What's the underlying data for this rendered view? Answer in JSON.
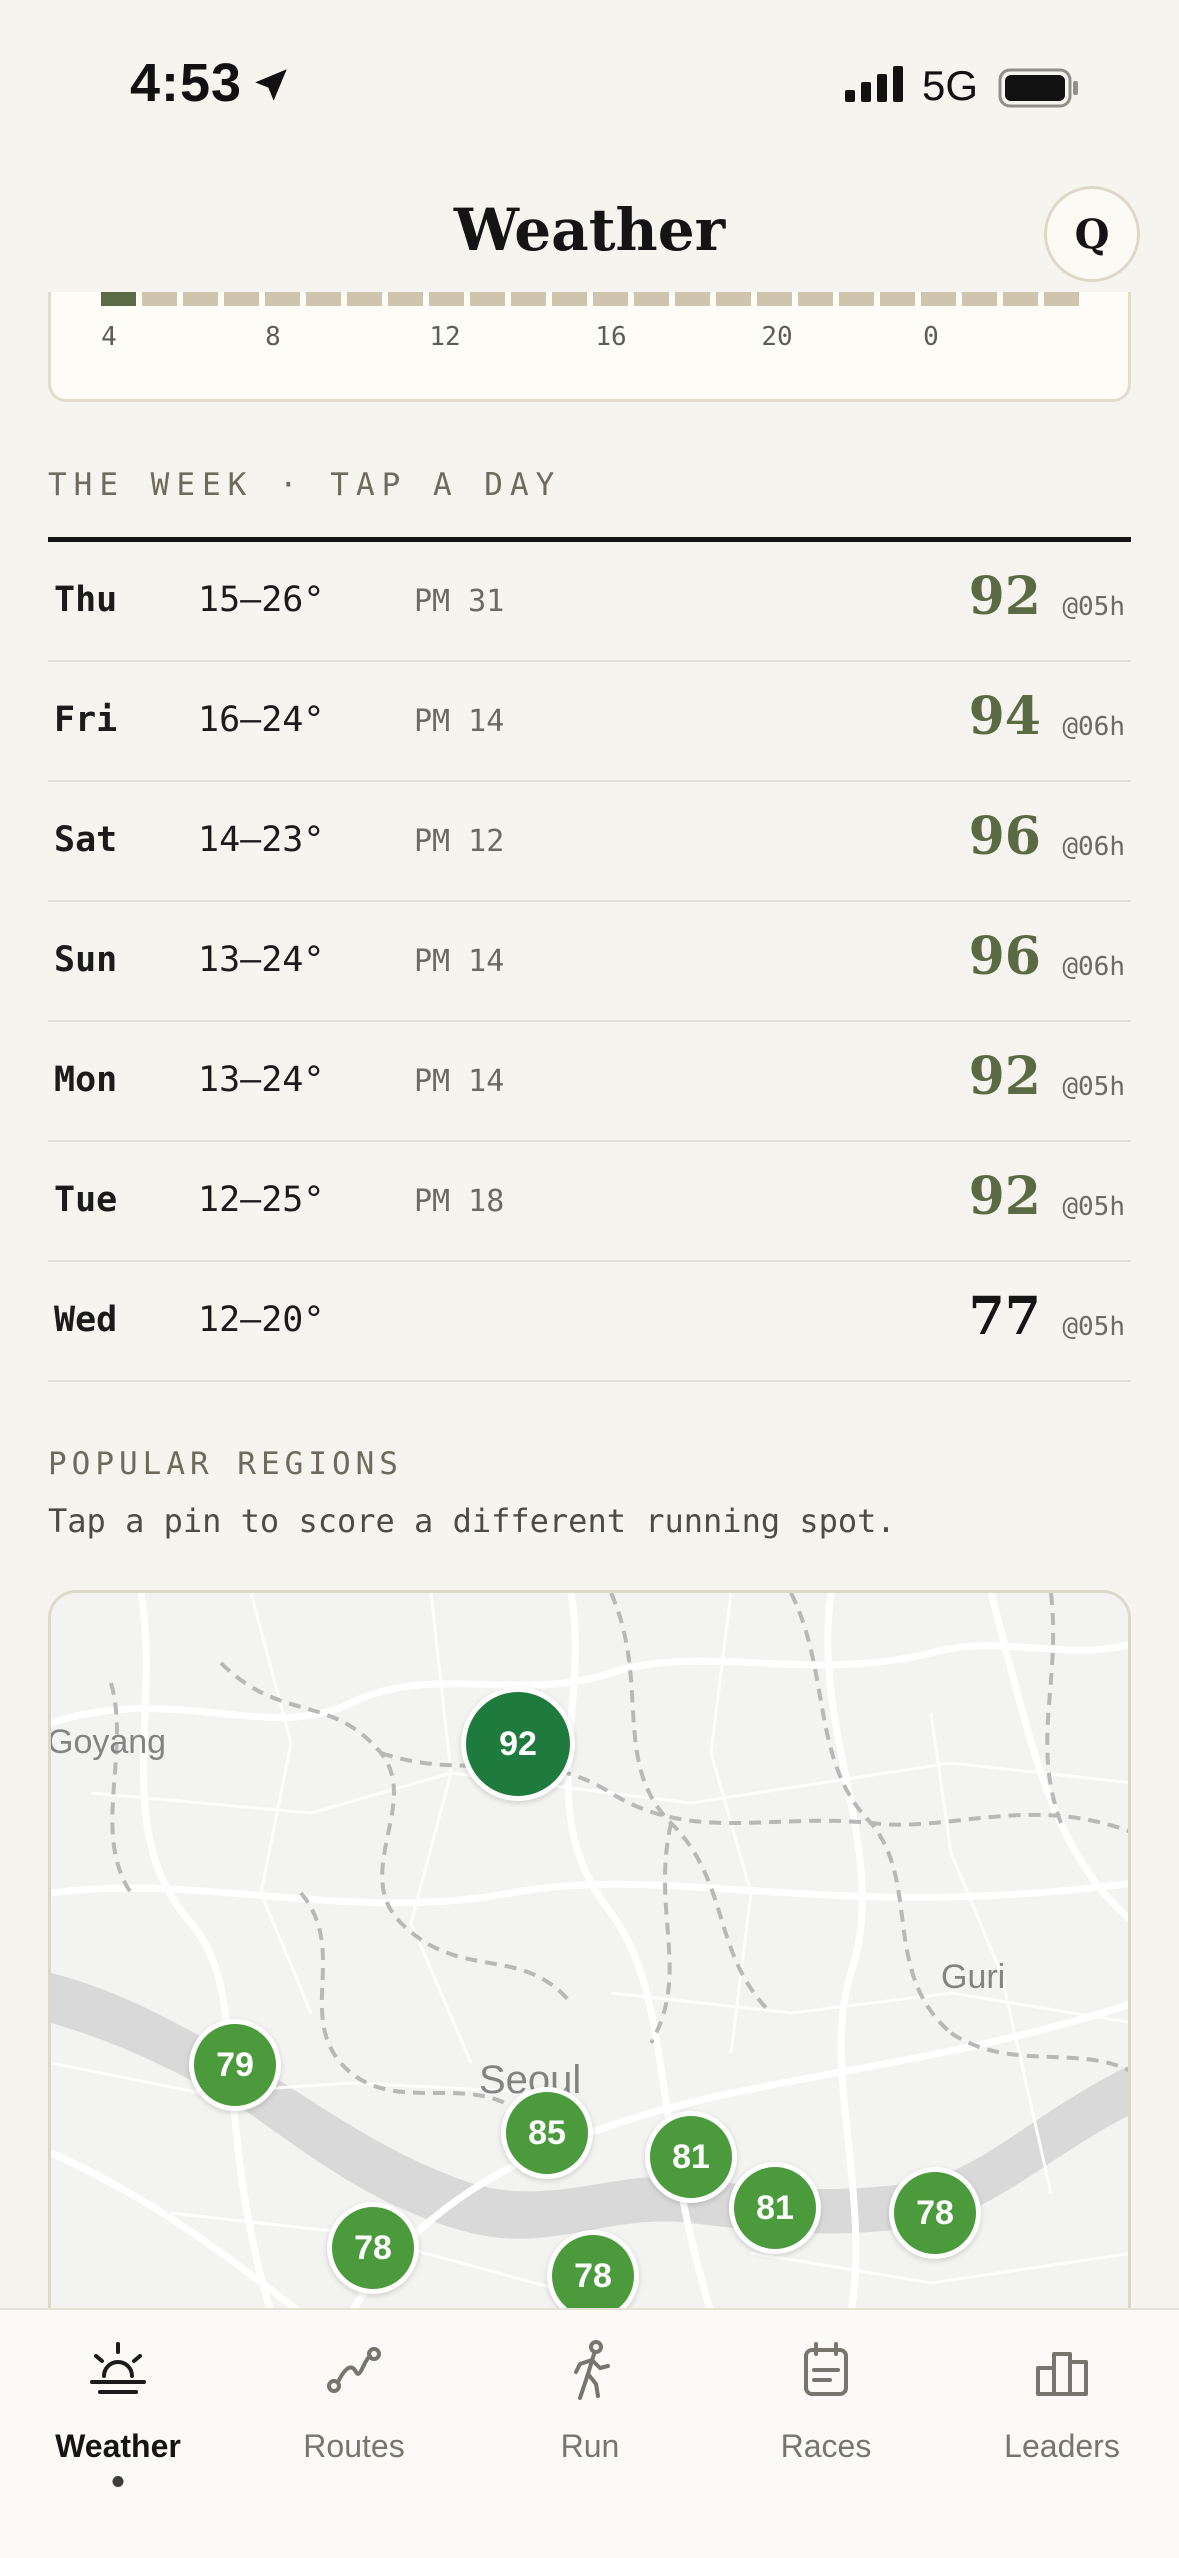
{
  "status_bar": {
    "time": "4:53",
    "network": "5G"
  },
  "header": {
    "title": "Weather",
    "profile_initial": "Q"
  },
  "hourly": {
    "hour_labels": [
      "4",
      "8",
      "12",
      "16",
      "20",
      "0"
    ],
    "active_index": 0
  },
  "week": {
    "label": "THE WEEK · TAP A DAY",
    "days": [
      {
        "day": "Thu",
        "temp": "15–26°",
        "pm": "PM 31",
        "score": "92",
        "at": "@05h"
      },
      {
        "day": "Fri",
        "temp": "16–24°",
        "pm": "PM 14",
        "score": "94",
        "at": "@06h"
      },
      {
        "day": "Sat",
        "temp": "14–23°",
        "pm": "PM 12",
        "score": "96",
        "at": "@06h"
      },
      {
        "day": "Sun",
        "temp": "13–24°",
        "pm": "PM 14",
        "score": "96",
        "at": "@06h"
      },
      {
        "day": "Mon",
        "temp": "13–24°",
        "pm": "PM 14",
        "score": "92",
        "at": "@05h"
      },
      {
        "day": "Tue",
        "temp": "12–25°",
        "pm": "PM 18",
        "score": "92",
        "at": "@05h"
      },
      {
        "day": "Wed",
        "temp": "12–20°",
        "pm": "",
        "score": "77",
        "at": "@05h"
      }
    ]
  },
  "regions": {
    "label": "POPULAR REGIONS",
    "subtitle": "Tap a pin to score a different running spot.",
    "map_labels": {
      "goyang": "Goyang",
      "guri": "Guri",
      "seoul": "Seoul"
    },
    "pins": [
      "92",
      "79",
      "85",
      "81",
      "81",
      "78",
      "78",
      "78"
    ]
  },
  "tabs": [
    {
      "label": "Weather",
      "icon": "sun-horizon-icon",
      "active": true
    },
    {
      "label": "Routes",
      "icon": "route-icon",
      "active": false
    },
    {
      "label": "Run",
      "icon": "runner-icon",
      "active": false
    },
    {
      "label": "Races",
      "icon": "calendar-icon",
      "active": false
    },
    {
      "label": "Leaders",
      "icon": "podium-icon",
      "active": false
    }
  ],
  "colors": {
    "score_green": "#5a6b44",
    "pin_green": "#4b9b3d",
    "pin_top": "#1f7a3e",
    "background": "#f6f4ef"
  }
}
